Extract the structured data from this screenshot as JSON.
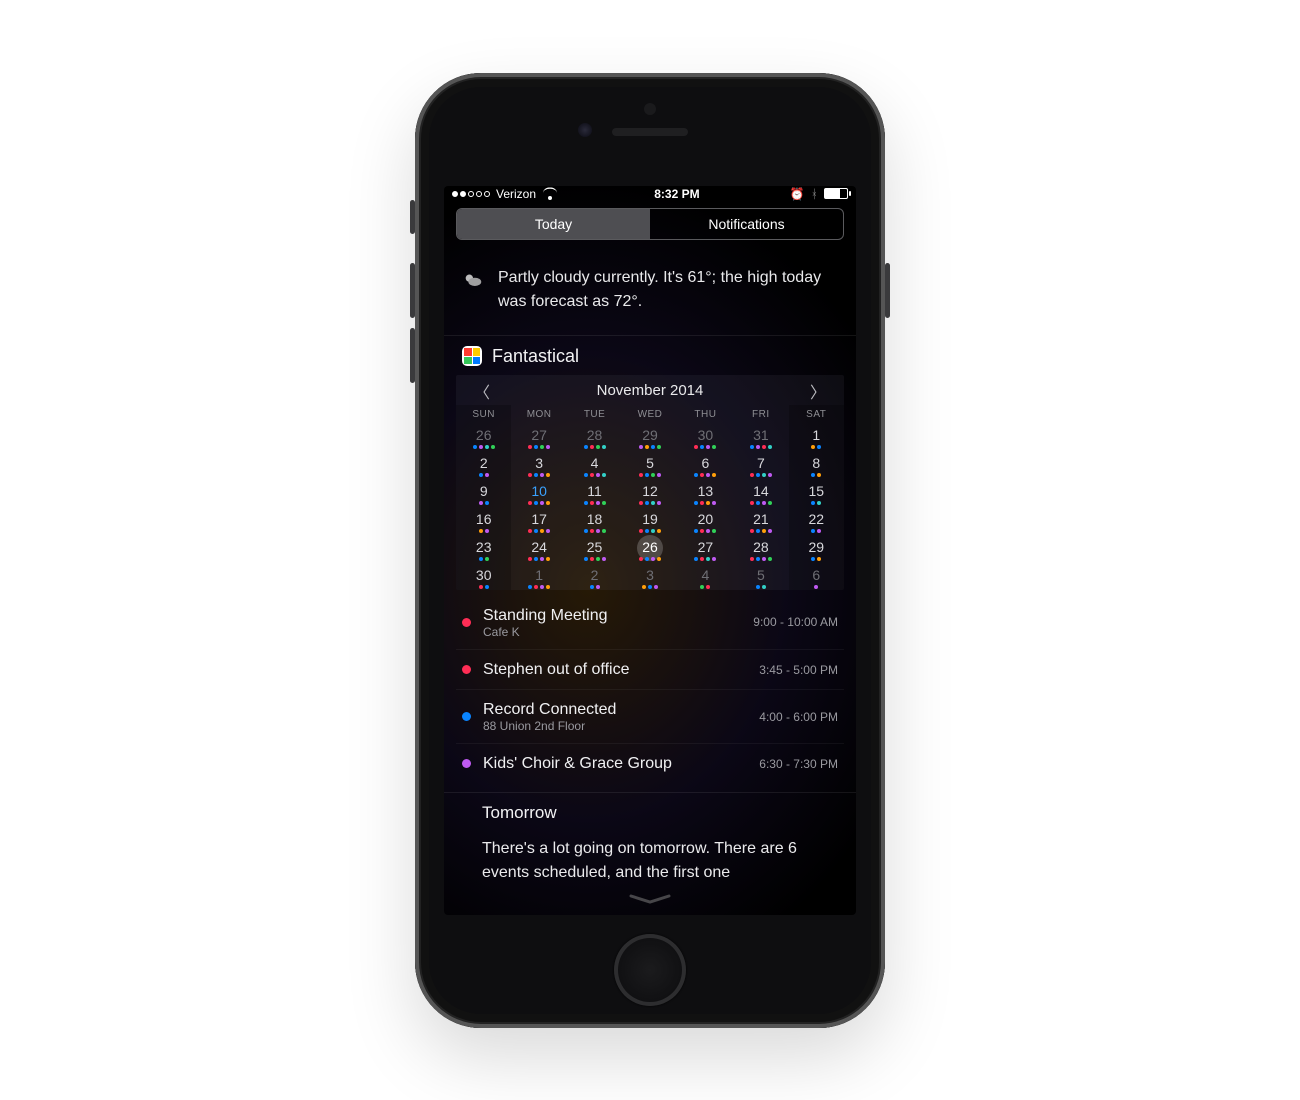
{
  "status": {
    "carrier": "Verizon",
    "signal_filled": 2,
    "time": "8:32 PM",
    "alarm_on": true,
    "bluetooth_on": true,
    "battery_pct": 70
  },
  "segmented": {
    "today": "Today",
    "notifications": "Notifications",
    "active": "today"
  },
  "weather": {
    "text": "Partly cloudy currently. It's 61°; the high today was forecast as 72°."
  },
  "widget": {
    "app_name": "Fantastical",
    "month_label": "November 2014",
    "dow": [
      "SUN",
      "MON",
      "TUE",
      "WED",
      "THU",
      "FRI",
      "SAT"
    ],
    "weeks": [
      [
        {
          "d": 26,
          "dim": 1,
          "dots": [
            "b",
            "p",
            "c",
            "g"
          ]
        },
        {
          "d": 27,
          "dim": 1,
          "dots": [
            "r",
            "b",
            "g",
            "p"
          ]
        },
        {
          "d": 28,
          "dim": 1,
          "dots": [
            "b",
            "r",
            "g",
            "c"
          ]
        },
        {
          "d": 29,
          "dim": 1,
          "dots": [
            "p",
            "o",
            "b",
            "g"
          ]
        },
        {
          "d": 30,
          "dim": 1,
          "dots": [
            "r",
            "b",
            "p",
            "g"
          ]
        },
        {
          "d": 31,
          "dim": 1,
          "dots": [
            "b",
            "p",
            "r",
            "c"
          ]
        },
        {
          "d": 1,
          "dots": [
            "o",
            "b"
          ]
        }
      ],
      [
        {
          "d": 2,
          "dots": [
            "b",
            "p"
          ]
        },
        {
          "d": 3,
          "dots": [
            "r",
            "b",
            "p",
            "o"
          ]
        },
        {
          "d": 4,
          "dots": [
            "b",
            "r",
            "p",
            "c"
          ]
        },
        {
          "d": 5,
          "dots": [
            "r",
            "b",
            "g",
            "p"
          ]
        },
        {
          "d": 6,
          "dots": [
            "b",
            "r",
            "p",
            "o"
          ]
        },
        {
          "d": 7,
          "dots": [
            "r",
            "b",
            "c",
            "p"
          ]
        },
        {
          "d": 8,
          "dots": [
            "b",
            "o"
          ]
        }
      ],
      [
        {
          "d": 9,
          "dots": [
            "p",
            "b"
          ]
        },
        {
          "d": 10,
          "hl": "blue",
          "dots": [
            "r",
            "b",
            "p",
            "o"
          ]
        },
        {
          "d": 11,
          "dots": [
            "b",
            "r",
            "p",
            "g"
          ]
        },
        {
          "d": 12,
          "dots": [
            "r",
            "b",
            "c",
            "p"
          ]
        },
        {
          "d": 13,
          "dots": [
            "b",
            "r",
            "o",
            "p"
          ]
        },
        {
          "d": 14,
          "dots": [
            "r",
            "b",
            "p",
            "g"
          ]
        },
        {
          "d": 15,
          "dots": [
            "b",
            "c"
          ]
        }
      ],
      [
        {
          "d": 16,
          "dots": [
            "o",
            "p"
          ]
        },
        {
          "d": 17,
          "dots": [
            "r",
            "b",
            "o",
            "p"
          ]
        },
        {
          "d": 18,
          "dots": [
            "b",
            "r",
            "p",
            "g"
          ]
        },
        {
          "d": 19,
          "dots": [
            "r",
            "b",
            "c",
            "o"
          ]
        },
        {
          "d": 20,
          "dots": [
            "b",
            "r",
            "p",
            "g"
          ]
        },
        {
          "d": 21,
          "dots": [
            "r",
            "b",
            "o",
            "p"
          ]
        },
        {
          "d": 22,
          "dots": [
            "b",
            "p"
          ]
        }
      ],
      [
        {
          "d": 23,
          "dots": [
            "b",
            "g"
          ]
        },
        {
          "d": 24,
          "dots": [
            "r",
            "b",
            "p",
            "o"
          ]
        },
        {
          "d": 25,
          "dots": [
            "b",
            "r",
            "g",
            "p"
          ]
        },
        {
          "d": 26,
          "today": 1,
          "dots": [
            "r",
            "b",
            "p",
            "o"
          ]
        },
        {
          "d": 27,
          "dots": [
            "b",
            "r",
            "c",
            "p"
          ]
        },
        {
          "d": 28,
          "dots": [
            "r",
            "b",
            "p",
            "g"
          ]
        },
        {
          "d": 29,
          "dots": [
            "b",
            "o"
          ]
        }
      ],
      [
        {
          "d": 30,
          "dots": [
            "r",
            "b"
          ]
        },
        {
          "d": 1,
          "dim": 1,
          "dots": [
            "b",
            "r",
            "p",
            "o"
          ]
        },
        {
          "d": 2,
          "dim": 1,
          "dots": [
            "b",
            "p"
          ]
        },
        {
          "d": 3,
          "dim": 1,
          "dots": [
            "o",
            "b",
            "p"
          ]
        },
        {
          "d": 4,
          "dim": 1,
          "dots": [
            "g",
            "r"
          ]
        },
        {
          "d": 5,
          "dim": 1,
          "dots": [
            "b",
            "c"
          ]
        },
        {
          "d": 6,
          "dim": 1,
          "dots": [
            "p"
          ]
        }
      ]
    ],
    "events": [
      {
        "color": "#ff2d55",
        "title": "Standing Meeting",
        "loc": "Cafe K",
        "time": "9:00 - 10:00 AM"
      },
      {
        "color": "#ff2d55",
        "title": "Stephen out of office",
        "loc": "",
        "time": "3:45 - 5:00 PM"
      },
      {
        "color": "#0a84ff",
        "title": "Record Connected",
        "loc": "88 Union 2nd Floor",
        "time": "4:00 - 6:00 PM"
      },
      {
        "color": "#bf5af2",
        "title": "Kids' Choir & Grace Group",
        "loc": "",
        "time": "6:30 - 7:30 PM"
      }
    ]
  },
  "tomorrow": {
    "heading": "Tomorrow",
    "text": "There's a lot going on tomorrow. There are 6 events scheduled, and the first one"
  }
}
